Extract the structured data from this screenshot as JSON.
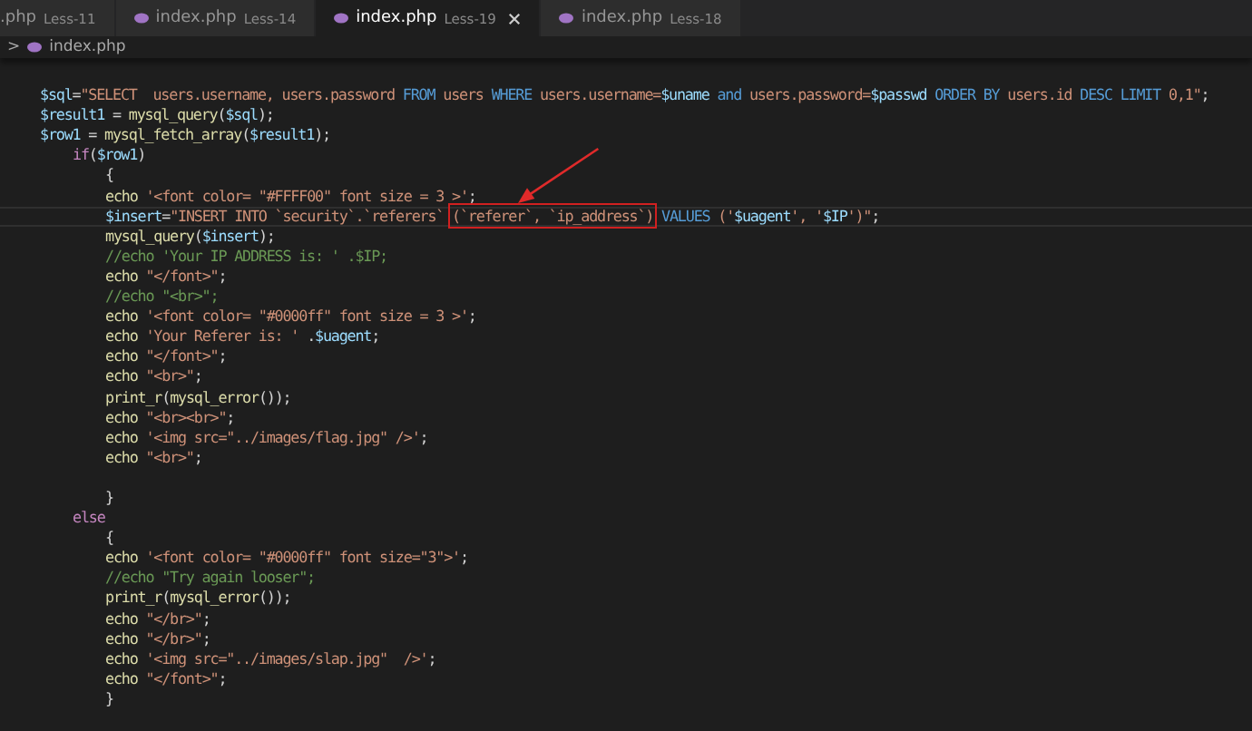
{
  "tabs": [
    {
      "file": ".php",
      "folder": "Less-11",
      "selected": false,
      "closable": false
    },
    {
      "file": "index.php",
      "folder": "Less-14",
      "selected": false,
      "closable": false
    },
    {
      "file": "index.php",
      "folder": "Less-19",
      "selected": true,
      "closable": true
    },
    {
      "file": "index.php",
      "folder": "Less-18",
      "selected": false,
      "closable": false
    }
  ],
  "breadcrumb": {
    "separator": ">",
    "file": "index.php"
  },
  "code": [
    {
      "space_above": true,
      "tokens": [
        {
          "kind": "variable",
          "s": "$sql"
        },
        {
          "kind": "punct",
          "s": "="
        },
        {
          "kind": "string",
          "s": "\"SELECT  users.username, users.password "
        },
        {
          "kind": "keyword",
          "s": "FROM"
        },
        {
          "kind": "string",
          "s": " users "
        },
        {
          "kind": "keyword",
          "s": "WHERE"
        },
        {
          "kind": "string",
          "s": " users.username="
        },
        {
          "kind": "variable",
          "s": "$uname"
        },
        {
          "kind": "keyword",
          "s": " and"
        },
        {
          "kind": "string",
          "s": " users.password="
        },
        {
          "kind": "variable",
          "s": "$passwd"
        },
        {
          "kind": "keyword",
          "s": " ORDER BY"
        },
        {
          "kind": "string",
          "s": " users.id "
        },
        {
          "kind": "keyword",
          "s": "DESC LIMIT"
        },
        {
          "kind": "string",
          "s": " 0,1\""
        },
        {
          "kind": "punct",
          "s": ";"
        }
      ]
    },
    {
      "tokens": [
        {
          "kind": "variable",
          "s": "$result1"
        },
        {
          "kind": "punct",
          "s": " = "
        },
        {
          "kind": "function",
          "s": "mysql_query"
        },
        {
          "kind": "punct",
          "s": "("
        },
        {
          "kind": "variable",
          "s": "$sql"
        },
        {
          "kind": "punct",
          "s": ");"
        }
      ]
    },
    {
      "tokens": [
        {
          "kind": "variable",
          "s": "$row1"
        },
        {
          "kind": "punct",
          "s": " = "
        },
        {
          "kind": "function",
          "s": "mysql_fetch_array"
        },
        {
          "kind": "punct",
          "s": "("
        },
        {
          "kind": "variable",
          "s": "$result1"
        },
        {
          "kind": "punct",
          "s": ");"
        }
      ],
      "children": [
        {
          "tokens": [
            {
              "kind": "control",
              "s": "if"
            },
            {
              "kind": "punct",
              "s": "("
            },
            {
              "kind": "variable",
              "s": "$row1"
            },
            {
              "kind": "punct",
              "s": ")"
            }
          ],
          "children": [
            {
              "tokens": [
                {
                  "kind": "punct",
                  "s": "{"
                }
              ]
            },
            {
              "tokens": [
                {
                  "kind": "function",
                  "s": "echo"
                },
                {
                  "kind": "string",
                  "s": " '<font color= \"#FFFF00\" font size = 3 >'"
                },
                {
                  "kind": "punct",
                  "s": ";"
                }
              ]
            },
            {
              "current": true,
              "tokens": [
                {
                  "kind": "variable",
                  "s": "$insert"
                },
                {
                  "kind": "punct",
                  "s": "="
                },
                {
                  "kind": "string",
                  "s": "\"INSERT INTO `security`.`referers` "
                },
                {
                  "kind": "string",
                  "s": "(`referer`, `ip_address`)",
                  "boxed": true
                },
                {
                  "kind": "keyword",
                  "s": " VALUES"
                },
                {
                  "kind": "string",
                  "s": " ('"
                },
                {
                  "kind": "variable",
                  "s": "$uagent"
                },
                {
                  "kind": "string",
                  "s": "', '"
                },
                {
                  "kind": "variable",
                  "s": "$IP"
                },
                {
                  "kind": "string",
                  "s": "')\""
                },
                {
                  "kind": "punct",
                  "s": ";"
                }
              ]
            },
            {
              "tokens": [
                {
                  "kind": "function",
                  "s": "mysql_query"
                },
                {
                  "kind": "punct",
                  "s": "("
                },
                {
                  "kind": "variable",
                  "s": "$insert"
                },
                {
                  "kind": "punct",
                  "s": ");"
                }
              ]
            },
            {
              "tokens": [
                {
                  "kind": "comment",
                  "s": "//echo 'Your IP ADDRESS is: ' .$IP;"
                }
              ]
            },
            {
              "tokens": [
                {
                  "kind": "function",
                  "s": "echo"
                },
                {
                  "kind": "string",
                  "s": " \"</font>\""
                },
                {
                  "kind": "punct",
                  "s": ";"
                }
              ]
            },
            {
              "tokens": [
                {
                  "kind": "comment",
                  "s": "//echo \"<br>\";"
                }
              ]
            },
            {
              "tokens": [
                {
                  "kind": "function",
                  "s": "echo"
                },
                {
                  "kind": "string",
                  "s": " '<font color= \"#0000ff\" font size = 3 >'"
                },
                {
                  "kind": "punct",
                  "s": ";"
                }
              ]
            },
            {
              "tokens": [
                {
                  "kind": "function",
                  "s": "echo"
                },
                {
                  "kind": "string",
                  "s": " 'Your Referer is: '"
                },
                {
                  "kind": "punct",
                  "s": " ."
                },
                {
                  "kind": "variable",
                  "s": "$uagent"
                },
                {
                  "kind": "punct",
                  "s": ";"
                }
              ]
            },
            {
              "tokens": [
                {
                  "kind": "function",
                  "s": "echo"
                },
                {
                  "kind": "string",
                  "s": " \"</font>\""
                },
                {
                  "kind": "punct",
                  "s": ";"
                }
              ]
            },
            {
              "tokens": [
                {
                  "kind": "function",
                  "s": "echo"
                },
                {
                  "kind": "string",
                  "s": " \"<br>\""
                },
                {
                  "kind": "punct",
                  "s": ";"
                }
              ]
            },
            {
              "tokens": [
                {
                  "kind": "function",
                  "s": "print_r"
                },
                {
                  "kind": "punct",
                  "s": "("
                },
                {
                  "kind": "function",
                  "s": "mysql_error"
                },
                {
                  "kind": "punct",
                  "s": "());"
                }
              ]
            },
            {
              "tokens": [
                {
                  "kind": "function",
                  "s": "echo"
                },
                {
                  "kind": "string",
                  "s": " \"<br><br>\""
                },
                {
                  "kind": "punct",
                  "s": ";"
                }
              ]
            },
            {
              "tokens": [
                {
                  "kind": "function",
                  "s": "echo"
                },
                {
                  "kind": "string",
                  "s": " '<img src=\"../images/flag.jpg\" />'"
                },
                {
                  "kind": "punct",
                  "s": ";"
                }
              ]
            },
            {
              "tokens": [
                {
                  "kind": "function",
                  "s": "echo"
                },
                {
                  "kind": "string",
                  "s": " \"<br>\""
                },
                {
                  "kind": "punct",
                  "s": ";"
                }
              ]
            },
            {
              "space_above": true,
              "tokens": [
                {
                  "kind": "punct",
                  "s": "}"
                }
              ]
            }
          ]
        },
        {
          "tokens": [
            {
              "kind": "control",
              "s": "else"
            }
          ],
          "children": [
            {
              "tokens": [
                {
                  "kind": "punct",
                  "s": "{"
                }
              ]
            },
            {
              "tokens": [
                {
                  "kind": "function",
                  "s": "echo"
                },
                {
                  "kind": "string",
                  "s": " '<font color= \"#0000ff\" font size=\"3\">'"
                },
                {
                  "kind": "punct",
                  "s": ";"
                }
              ]
            },
            {
              "tokens": [
                {
                  "kind": "comment",
                  "s": "//echo \"Try again looser\";"
                }
              ]
            },
            {
              "tokens": [
                {
                  "kind": "function",
                  "s": "print_r"
                },
                {
                  "kind": "punct",
                  "s": "("
                },
                {
                  "kind": "function",
                  "s": "mysql_error"
                },
                {
                  "kind": "punct",
                  "s": "());"
                }
              ]
            },
            {
              "tokens": [
                {
                  "kind": "function",
                  "s": "echo"
                },
                {
                  "kind": "string",
                  "s": " \"</br>\""
                },
                {
                  "kind": "punct",
                  "s": ";"
                }
              ]
            },
            {
              "tokens": [
                {
                  "kind": "function",
                  "s": "echo"
                },
                {
                  "kind": "string",
                  "s": " \"</br>\""
                },
                {
                  "kind": "punct",
                  "s": ";"
                }
              ]
            },
            {
              "tokens": [
                {
                  "kind": "function",
                  "s": "echo"
                },
                {
                  "kind": "string",
                  "s": " '<img src=\"../images/slap.jpg\"  />'"
                },
                {
                  "kind": "punct",
                  "s": ";"
                }
              ]
            },
            {
              "tokens": [
                {
                  "kind": "function",
                  "s": "echo"
                },
                {
                  "kind": "string",
                  "s": " \"</font>\""
                },
                {
                  "kind": "punct",
                  "s": ";"
                }
              ]
            },
            {
              "tokens": [
                {
                  "kind": "punct",
                  "s": "}"
                }
              ]
            }
          ]
        }
      ]
    }
  ]
}
